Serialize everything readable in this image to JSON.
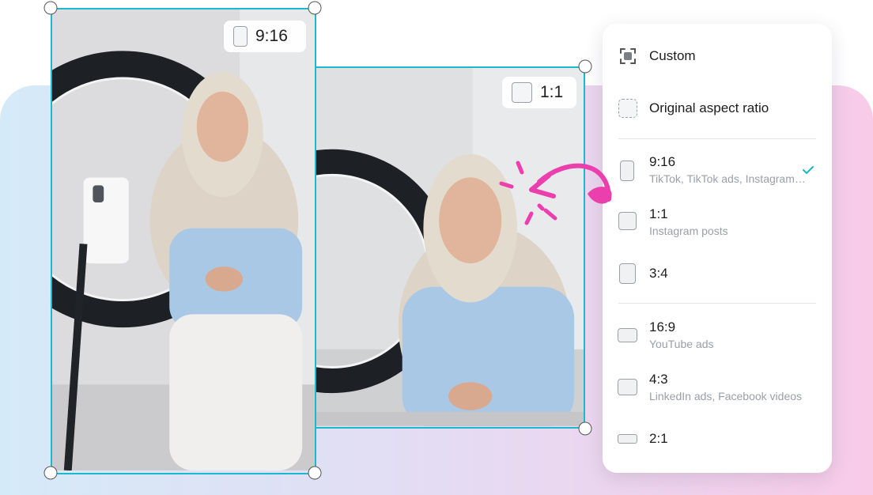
{
  "frames": {
    "portrait_tag": "9:16",
    "square_tag": "1:1"
  },
  "menu": {
    "custom_label": "Custom",
    "original_label": "Original aspect ratio",
    "items": [
      {
        "label": "9:16",
        "sub": "TikTok, TikTok ads, Instagram Reels",
        "selected": true
      },
      {
        "label": "1:1",
        "sub": "Instagram posts",
        "selected": false
      },
      {
        "label": "3:4",
        "sub": "",
        "selected": false
      },
      {
        "label": "16:9",
        "sub": "YouTube ads",
        "selected": false
      },
      {
        "label": "4:3",
        "sub": "LinkedIn ads, Facebook videos",
        "selected": false
      },
      {
        "label": "2:1",
        "sub": "",
        "selected": false
      }
    ]
  },
  "colors": {
    "accent": "#1bb8cf",
    "arrow": "#ec3fae"
  },
  "icons": {
    "custom": "crop-icon",
    "original": "dashed-frame-icon",
    "selected": "check-icon"
  }
}
